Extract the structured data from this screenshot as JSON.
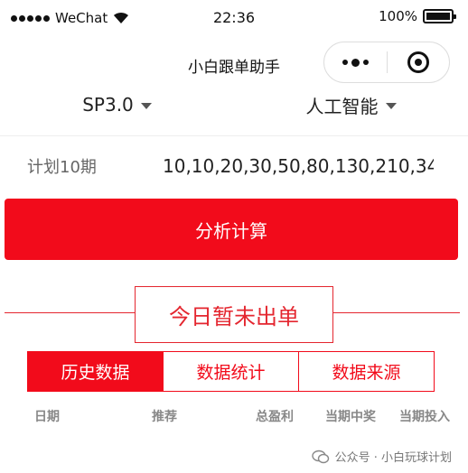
{
  "status_bar": {
    "carrier": "WeChat",
    "time": "22:36",
    "battery_pct": "100%",
    "battery_level": 1.0
  },
  "nav": {
    "title": "小白跟单助手"
  },
  "selectors": {
    "left": "SP3.0",
    "right": "人工智能"
  },
  "plan": {
    "label": "计划10期",
    "value": "10,10,20,30,50,80,130,210,34"
  },
  "analyze_button": "分析计算",
  "notice": "今日暂未出单",
  "tabs": [
    {
      "label": "历史数据",
      "active": true
    },
    {
      "label": "数据统计",
      "active": false
    },
    {
      "label": "数据来源",
      "active": false
    }
  ],
  "table": {
    "headers": [
      "日期",
      "推荐",
      "总盈利",
      "当期中奖",
      "当期投入"
    ]
  },
  "watermark": "公众号 · 小白玩球计划",
  "colors": {
    "accent": "#f20b1b",
    "notice": "#e4262f"
  }
}
